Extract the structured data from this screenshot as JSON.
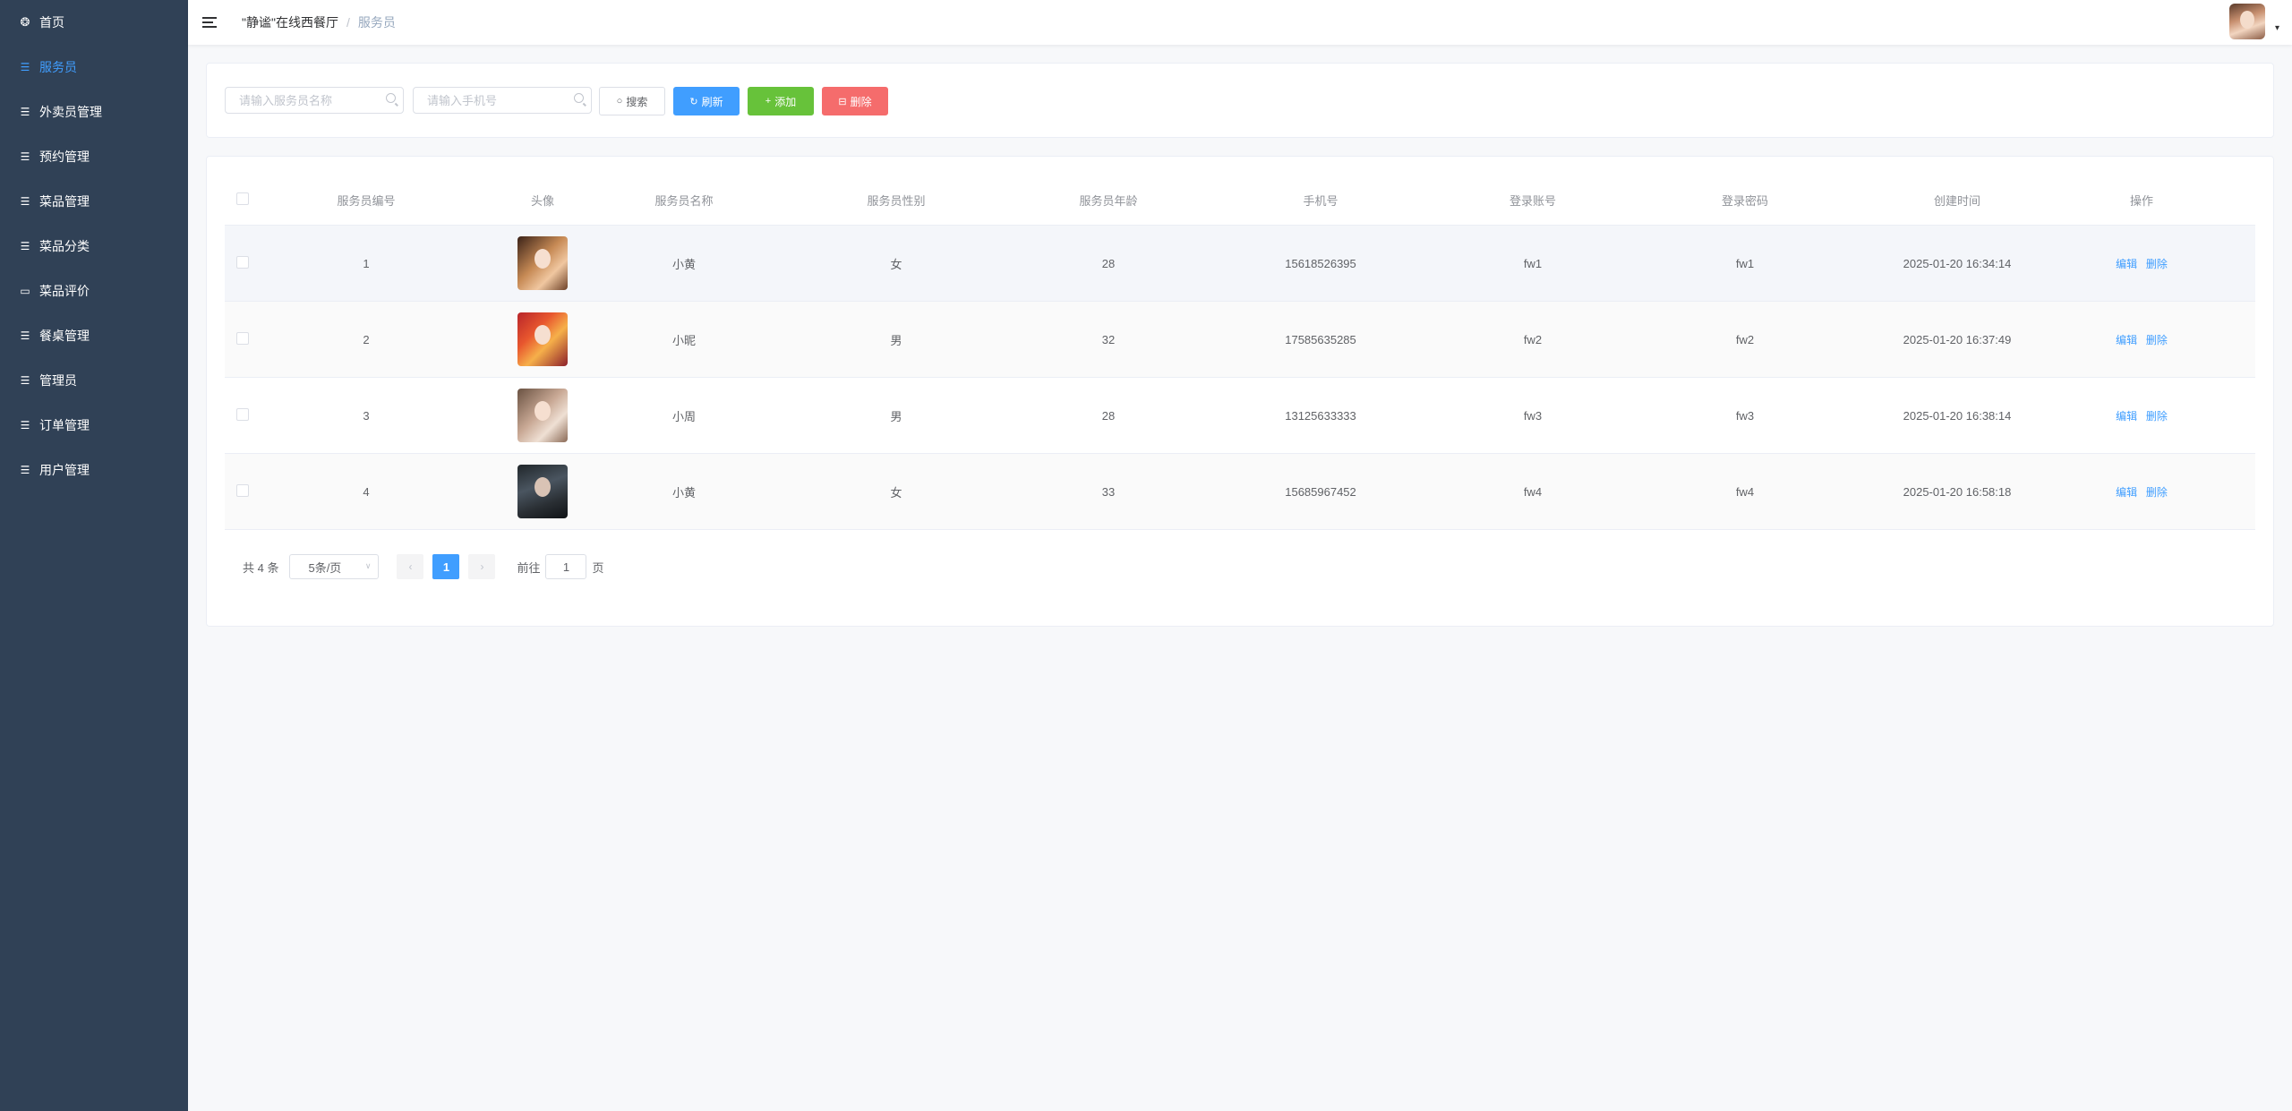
{
  "sidebar": {
    "items": [
      {
        "label": "首页",
        "icon": "dashboard-icon",
        "active": false
      },
      {
        "label": "服务员",
        "icon": "sliders-icon",
        "active": true
      },
      {
        "label": "外卖员管理",
        "icon": "sliders-icon",
        "active": false
      },
      {
        "label": "预约管理",
        "icon": "sliders-icon",
        "active": false
      },
      {
        "label": "菜品管理",
        "icon": "sliders-icon",
        "active": false
      },
      {
        "label": "菜品分类",
        "icon": "sliders-icon",
        "active": false
      },
      {
        "label": "菜品评价",
        "icon": "comment-icon",
        "active": false
      },
      {
        "label": "餐桌管理",
        "icon": "sliders-icon",
        "active": false
      },
      {
        "label": "管理员",
        "icon": "sliders-icon",
        "active": false
      },
      {
        "label": "订单管理",
        "icon": "sliders-icon",
        "active": false
      },
      {
        "label": "用户管理",
        "icon": "sliders-icon",
        "active": false
      }
    ]
  },
  "header": {
    "breadcrumb_home": "\"静谧\"在线西餐厅",
    "breadcrumb_sep": "/",
    "breadcrumb_current": "服务员"
  },
  "search": {
    "name_placeholder": "请输入服务员名称",
    "name_value": "",
    "phone_placeholder": "请输入手机号",
    "phone_value": "",
    "search_label": "搜索",
    "refresh_label": "刷新",
    "add_label": "添加",
    "delete_label": "删除"
  },
  "table": {
    "columns": [
      "服务员编号",
      "头像",
      "服务员名称",
      "服务员性别",
      "服务员年龄",
      "手机号",
      "登录账号",
      "登录密码",
      "创建时间",
      "操作"
    ],
    "rows": [
      {
        "id": "1",
        "name": "小黄",
        "sex": "女",
        "age": "28",
        "phone": "15618526395",
        "account": "fw1",
        "password": "fw1",
        "created": "2025-01-20 16:34:14"
      },
      {
        "id": "2",
        "name": "小昵",
        "sex": "男",
        "age": "32",
        "phone": "17585635285",
        "account": "fw2",
        "password": "fw2",
        "created": "2025-01-20 16:37:49"
      },
      {
        "id": "3",
        "name": "小周",
        "sex": "男",
        "age": "28",
        "phone": "13125633333",
        "account": "fw3",
        "password": "fw3",
        "created": "2025-01-20 16:38:14"
      },
      {
        "id": "4",
        "name": "小黄",
        "sex": "女",
        "age": "33",
        "phone": "15685967452",
        "account": "fw4",
        "password": "fw4",
        "created": "2025-01-20 16:58:18"
      }
    ],
    "edit_label": "编辑",
    "delete_label": "删除"
  },
  "pagination": {
    "total": "共 4 条",
    "page_size": "5条/页",
    "current_page": "1",
    "goto_prefix": "前往",
    "goto_value": "1",
    "goto_suffix": "页"
  },
  "colors": {
    "sidebar_bg": "#304156",
    "primary": "#409eff",
    "success": "#67c23a",
    "danger": "#f56c6c"
  }
}
